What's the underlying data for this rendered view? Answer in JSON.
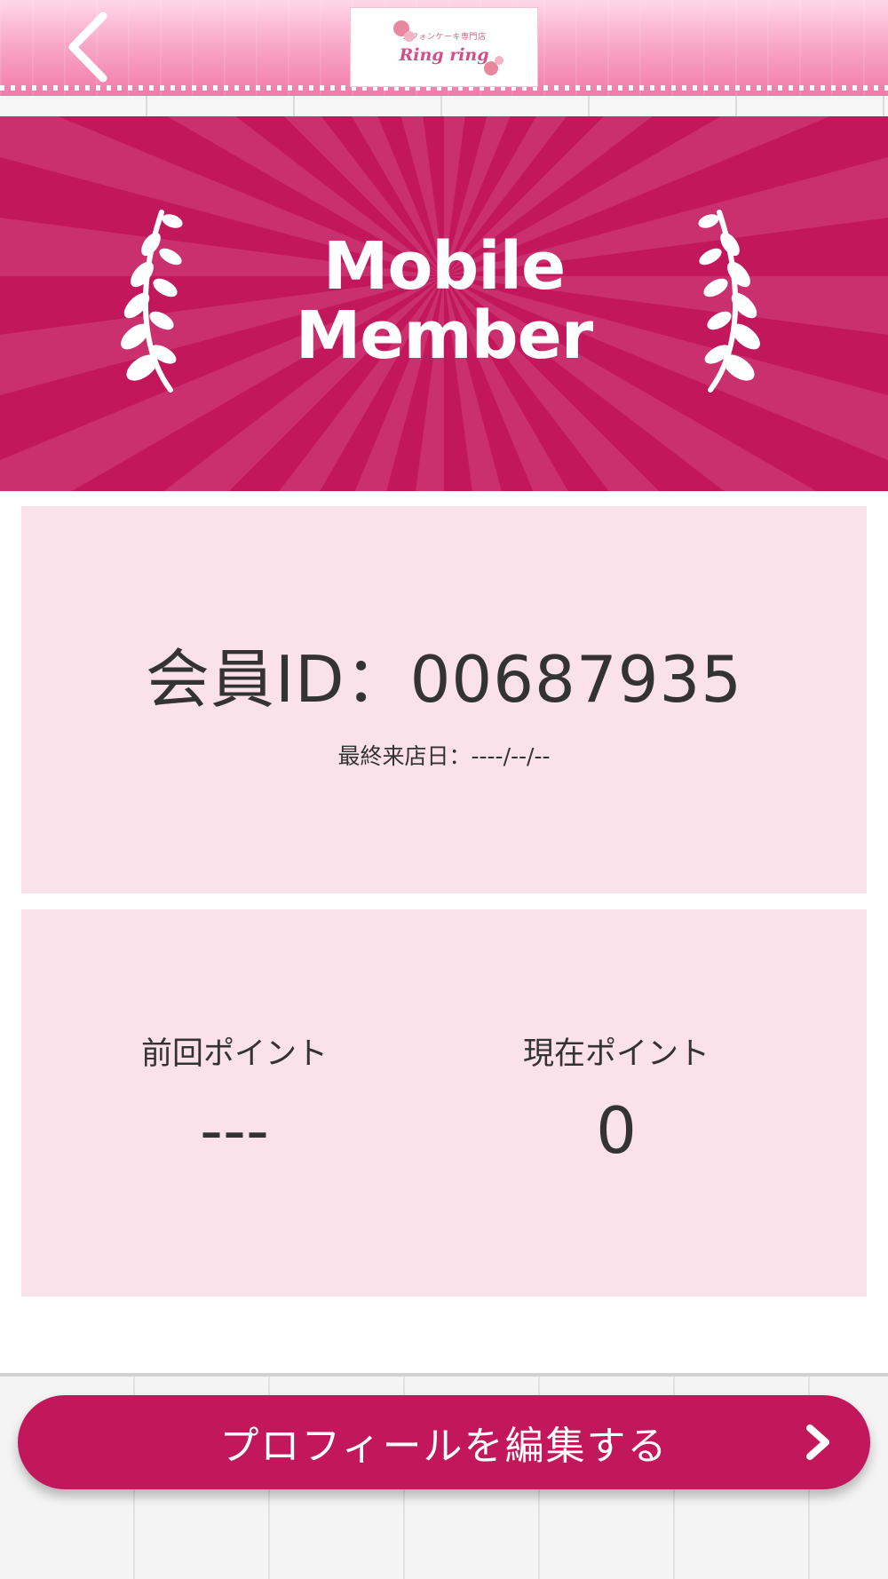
{
  "header": {
    "back_icon": "chevron-left-icon",
    "logo": {
      "subtitle": "シフォンケーキ専門店",
      "name": "Ring ring"
    }
  },
  "banner": {
    "title_line1": "Mobile",
    "title_line2": "Member",
    "background_color": "#c2185b",
    "ray_color": "#d1457b",
    "left_icon": "laurel-branch-icon",
    "right_icon": "laurel-branch-icon"
  },
  "member": {
    "id_text": "会員ID：00687935",
    "last_visit_text": "最終来店日：----/--/--"
  },
  "points": {
    "previous_label": "前回ポイント",
    "previous_value": "---",
    "current_label": "現在ポイント",
    "current_value": "0"
  },
  "actions": {
    "edit_profile_label": "プロフィールを編集する",
    "edit_profile_icon": "chevron-right-icon",
    "accent_color": "#c2185b"
  },
  "colors": {
    "card_bg": "#fbe2ea",
    "header_pink": "#f27aab"
  }
}
